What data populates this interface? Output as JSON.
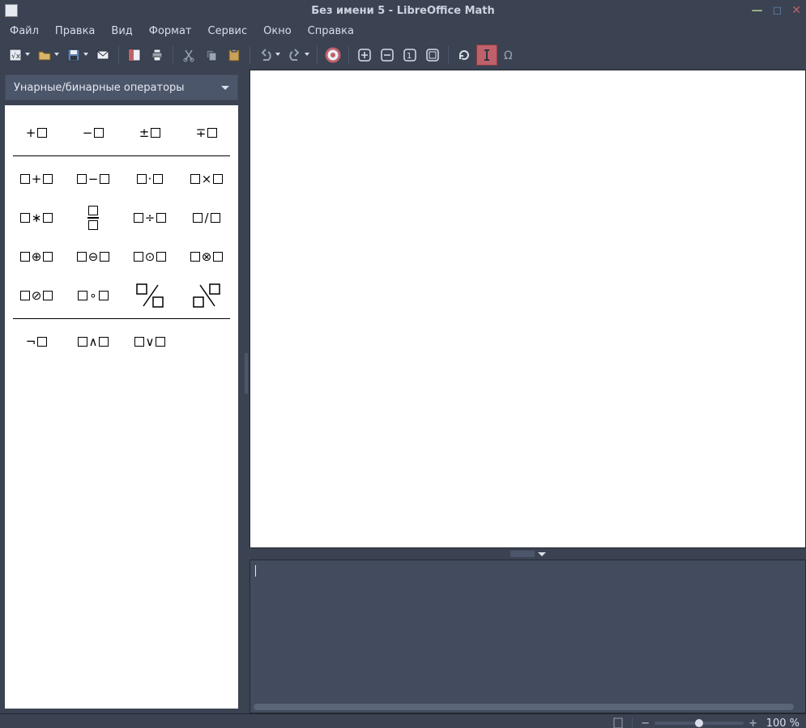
{
  "window": {
    "title": "Без имени 5 - LibreOffice Math"
  },
  "menu": {
    "items": [
      "Файл",
      "Правка",
      "Вид",
      "Формат",
      "Сервис",
      "Окно",
      "Справка"
    ]
  },
  "toolbar": {
    "icons": [
      "new-formula",
      "open",
      "save",
      "mail",
      "export-pdf",
      "print",
      "cut",
      "copy",
      "paste",
      "undo",
      "redo",
      "help",
      "zoom-in",
      "zoom-out",
      "zoom-100",
      "zoom-fit",
      "update",
      "cursor",
      "symbols"
    ]
  },
  "elements_panel": {
    "category": "Унарные/бинарные операторы",
    "groups": [
      {
        "rows": [
          [
            "plus-a",
            "minus-a",
            "plus-minus-a",
            "minus-plus-a"
          ]
        ]
      },
      {
        "rows": [
          [
            "a-plus-b",
            "a-minus-b",
            "a-dot-b",
            "a-times-b"
          ],
          [
            "a-star-b",
            "a-over-b",
            "a-div-b",
            "a-slash-b"
          ],
          [
            "a-oplus-b",
            "a-ominus-b",
            "a-odot-b",
            "a-otimes-b"
          ],
          [
            "a-oslash-b",
            "a-circ-b",
            "a-wideslash-b",
            "a-widebslash-b"
          ]
        ]
      },
      {
        "rows": [
          [
            "not-a",
            "a-and-b",
            "a-or-b"
          ]
        ]
      }
    ]
  },
  "command_input": {
    "value": ""
  },
  "status": {
    "zoom": "100 %"
  }
}
